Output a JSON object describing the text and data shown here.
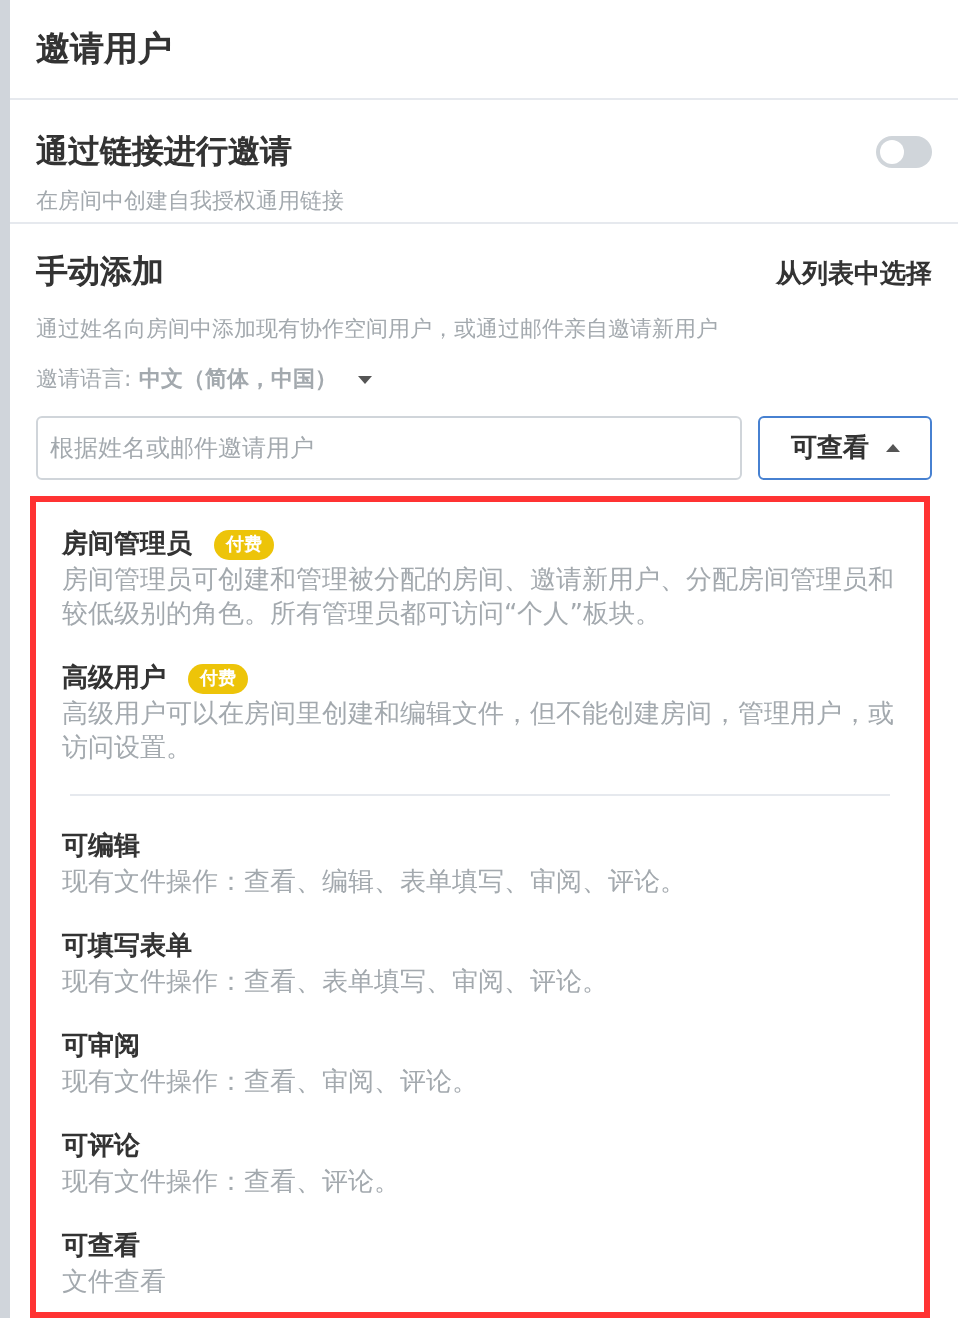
{
  "header": {
    "title": "邀请用户"
  },
  "link_invite": {
    "title": "通过链接进行邀请",
    "description": "在房间中创建自我授权通用链接",
    "on": false
  },
  "manual_add": {
    "title": "手动添加",
    "list_link": "从列表中选择",
    "description": "通过姓名向房间中添加现有协作空间用户，或通过邮件亲自邀请新用户",
    "language_label": "邀请语言:",
    "language_value": "中文（简体，中国）",
    "search": {
      "placeholder": "根据姓名或邮件邀请用户"
    },
    "role_button": {
      "label": "可查看",
      "expanded": true
    }
  },
  "role_menu": {
    "highlighted": true,
    "groups": [
      [
        {
          "title": "房间管理员",
          "badge": "付费",
          "description": "房间管理员可创建和管理被分配的房间、邀请新用户、分配房间管理员和较低级别的角色。所有管理员都可访问“个人”板块。"
        },
        {
          "title": "高级用户",
          "badge": "付费",
          "description": "高级用户可以在房间里创建和编辑文件，但不能创建房间，管理用户，或访问设置。"
        }
      ],
      [
        {
          "title": "可编辑",
          "description": "现有文件操作：查看、编辑、表单填写、审阅、评论。"
        },
        {
          "title": "可填写表单",
          "description": "现有文件操作：查看、表单填写、审阅、评论。"
        },
        {
          "title": "可审阅",
          "description": "现有文件操作：查看、审阅、评论。"
        },
        {
          "title": "可评论",
          "description": "现有文件操作：查看、评论。"
        },
        {
          "title": "可查看",
          "description": "文件查看"
        }
      ]
    ]
  }
}
